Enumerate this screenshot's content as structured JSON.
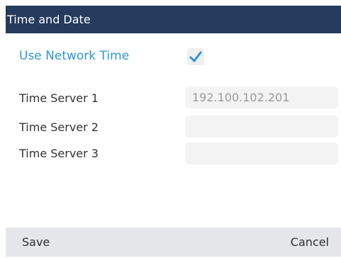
{
  "header": {
    "title": "Time and Date"
  },
  "settings": {
    "use_network_time": {
      "label": "Use Network Time",
      "checked": true
    },
    "time_servers": [
      {
        "label": "Time Server 1",
        "value": "192.100.102.201"
      },
      {
        "label": "Time Server 2",
        "value": ""
      },
      {
        "label": "Time Server 3",
        "value": ""
      }
    ]
  },
  "softkeys": {
    "save_label": "Save",
    "cancel_label": "Cancel"
  },
  "colors": {
    "title_bar": "#243b5e",
    "accent": "#2f95d6",
    "softkey_bar": "#e5e6e9",
    "field_bg": "#f3f3f3"
  },
  "icons": {
    "checkbox": "checkmark-icon"
  }
}
